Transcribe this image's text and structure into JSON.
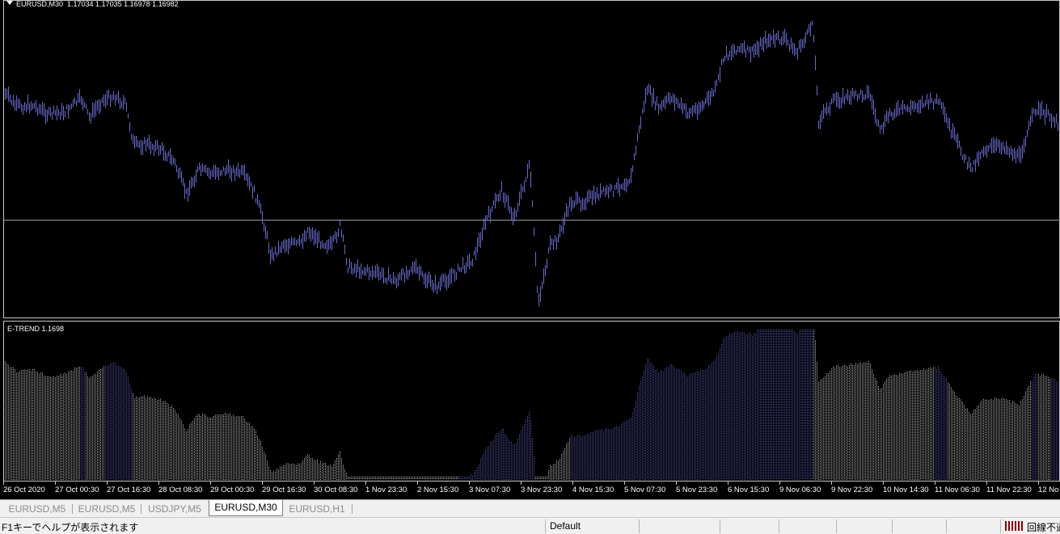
{
  "chart": {
    "main_window": {
      "title": "EURUSD,M30  1.17034 1.17035 1.16978 1.16982",
      "bar_color": "#6a6acd",
      "background": "#000000",
      "horizontal_line_color": "#c0c0c0"
    },
    "indicator_window": {
      "title": "E-TREND 1.1698",
      "up_color": "#5a5ab4",
      "down_color": "#c8c8c8"
    },
    "time_axis": [
      "26 Oct 2020",
      "27 Oct 00:30",
      "27 Oct 16:30",
      "28 Oct 08:30",
      "29 Oct 00:30",
      "29 Oct 16:30",
      "30 Oct 08:30",
      "1 Nov 23:30",
      "2 Nov 15:30",
      "3 Nov 07:30",
      "3 Nov 23:30",
      "4 Nov 15:30",
      "5 Nov 07:30",
      "5 Nov 23:30",
      "6 Nov 15:30",
      "9 Nov 06:30",
      "9 Nov 22:30",
      "10 Nov 14:30",
      "11 Nov 06:30",
      "11 Nov 22:30",
      "12 No"
    ]
  },
  "tabs": [
    {
      "label": "EURUSD,M5",
      "active": false
    },
    {
      "label": "EURUSD,M5",
      "active": false
    },
    {
      "label": "USDJPY,M5",
      "active": false
    },
    {
      "label": "EURUSD,M30",
      "active": true
    },
    {
      "label": "EURUSD,H1",
      "active": false
    }
  ],
  "status": {
    "help_text": "F1キーでヘルプが表示されます",
    "profile": "Default",
    "connection": "回線不通"
  }
}
